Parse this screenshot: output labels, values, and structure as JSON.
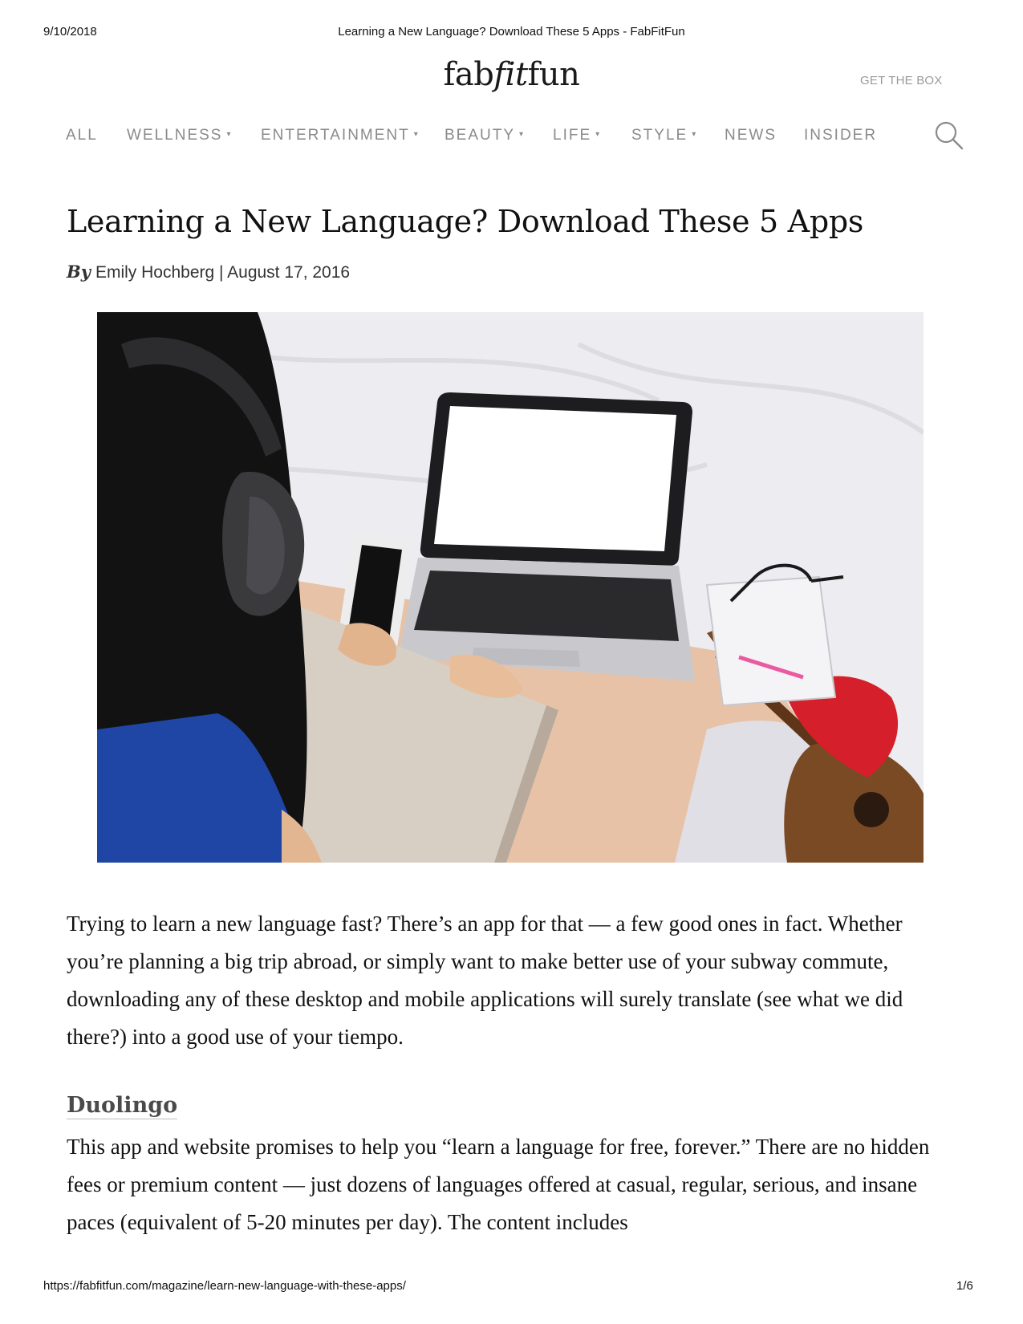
{
  "print_header": {
    "date": "9/10/2018",
    "title": "Learning a New Language? Download These 5 Apps - FabFitFun"
  },
  "site": {
    "logo_parts": [
      "fab",
      "fit",
      "fun"
    ],
    "get_box_label": "GET THE BOX"
  },
  "nav": {
    "items": [
      {
        "label": "ALL",
        "dropdown": false
      },
      {
        "label": "WELLNESS",
        "dropdown": true
      },
      {
        "label": "ENTERTAINMENT",
        "dropdown": true
      },
      {
        "label": "BEAUTY",
        "dropdown": true
      },
      {
        "label": "LIFE",
        "dropdown": true
      },
      {
        "label": "STYLE",
        "dropdown": true
      },
      {
        "label": "NEWS",
        "dropdown": false
      },
      {
        "label": "INSIDER",
        "dropdown": false
      }
    ],
    "caret": "▾",
    "search_icon": "search-icon"
  },
  "article": {
    "headline": "Learning a New Language? Download These 5 Apps",
    "byline_prefix": "By",
    "byline_rest": "Emily Hochberg | August 17, 2016",
    "hero_image": "woman-with-headphones-phone-laptop-on-bed",
    "paragraph1": "Trying to learn a new language fast? There’s an app for that — a few good ones in fact. Whether you’re planning a big trip abroad, or simply want to make better use of your subway commute, downloading any of these desktop and mobile applications will surely translate (see what we did there?) into a good use of your tiempo.",
    "subhead1": "Duolingo",
    "paragraph2": "This app and website promises to help you “learn a language for free, forever.” There are no hidden fees or premium content — just dozens of languages offered at casual, regular, serious, and insane paces (equivalent of 5-20 minutes per day). The content includes"
  },
  "print_footer": {
    "url": "https://fabfitfun.com/magazine/learn-new-language-with-these-apps/",
    "page": "1/6"
  }
}
